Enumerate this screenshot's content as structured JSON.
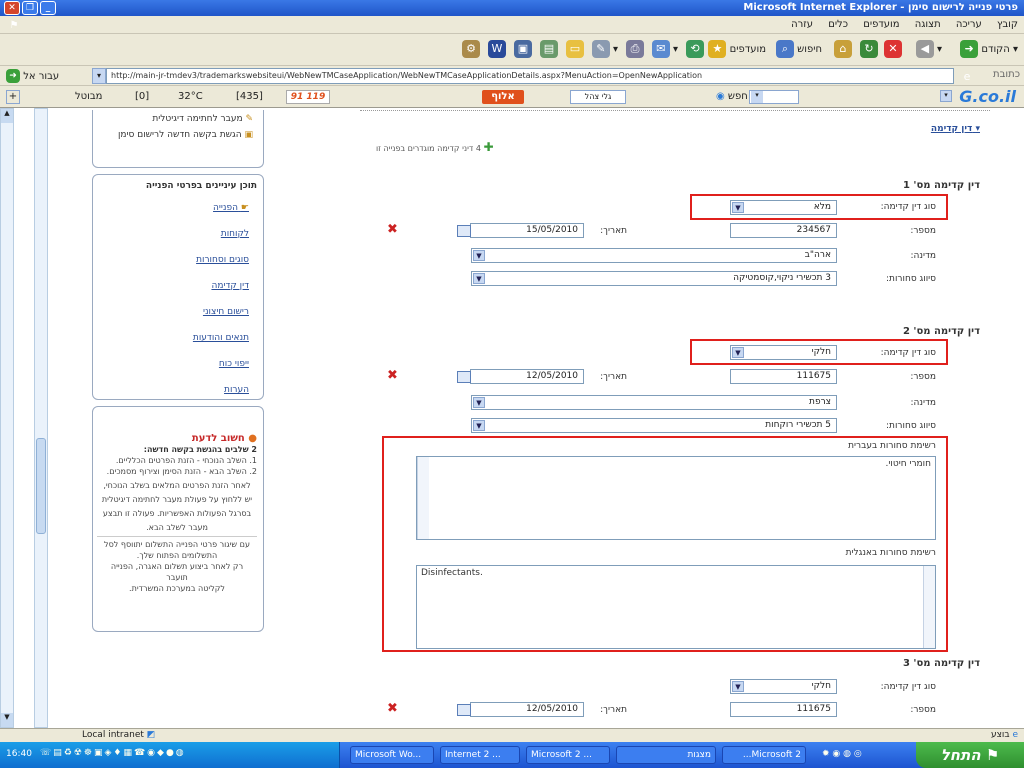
{
  "window": {
    "title": "פרטי פנייה לרישום סימן - Microsoft Internet Explorer"
  },
  "menu": [
    "קובץ",
    "עריכה",
    "תצוגה",
    "מועדפים",
    "כלים",
    "עזרה"
  ],
  "toolbar": {
    "back": "הקודם",
    "search": "חיפוש",
    "favorites": "מועדפים"
  },
  "address": {
    "label": "כתובת",
    "url": "http://main-jr-tmdev3/trademarkswebsiteui/WebNewTMCaseApplication/WebNewTMCaseApplicationDetails.aspx?MenuAction=OpenNewApplication",
    "go": "עבור אל"
  },
  "links": {
    "logo": "G.co.il",
    "search": "חפש",
    "alef": "אלוף",
    "temp": "32°C",
    "count_435": "[435]",
    "count_0": "[0]",
    "protected": "מבוטל",
    "news": "91 119",
    "gif": "גלי צהל"
  },
  "sidebar": {
    "top_items": [
      "מעבר לחתימה דיגיטלית",
      "הגשת בקשה חדשה לרישום סימן"
    ],
    "section_title": "תוכן עיניינים בפרטי הפנייה",
    "items": [
      "הפנייה",
      "לקוחות",
      "סוגים וסחורות",
      "דין קדימה",
      "רישום חיצוני",
      "תנאים והודעות",
      "ייפוי כוח",
      "הערות"
    ],
    "notice": {
      "title": "חשוב לדעת",
      "subtitle": "2 שלבים בהגשת בקשה חדשה:",
      "lines": [
        "1. השלב הנוכחי - הזנת הפרטים הכלליים.",
        "2. השלב הבא - הזנת הסימן וצירוף מסמכים.",
        "לאחר הזנת הפרטים המלאים בשלב הנוכחי,",
        "יש ללחוץ על פעולת מעבר לחתימה דיגיטלית",
        "בסרגל הפעולות האפשריות. פעולה זו תבצע",
        "מעבר לשלב הבא.",
        "עם שיגור פרטי הפנייה התשלום יתווסף לסל",
        "התשלומים הפתוח שלך.",
        "רק לאחר ביצוע תשלום האגרה, הפנייה",
        "תועבר",
        "לקליטה במערכת המשרדית."
      ]
    }
  },
  "main": {
    "header_link": "דין קדימה",
    "add_text": "4 דיני קדימה מוגדרים בפנייה זו",
    "labels": {
      "type": "סוג דין קדימה:",
      "number": "מספר:",
      "date": "תאריך:",
      "country": "מדינה:",
      "class": "סיווג סחורות:"
    },
    "priorities": [
      {
        "title": "דין קדימה מס' 1",
        "type": "מלא",
        "number": "234567",
        "date": "15/05/2010",
        "country": "ארה\"ב",
        "class": "3 תכשירי ניקוי,קוסמטיקה"
      },
      {
        "title": "דין קדימה מס' 2",
        "type": "חלקי",
        "number": "111675",
        "date": "12/05/2010",
        "country": "צרפת",
        "class": "5 תכשירי רוקחות"
      },
      {
        "title": "דין קדימה מס' 3",
        "type": "חלקי",
        "number": "111675",
        "date": "12/05/2010"
      }
    ],
    "goods_he": {
      "label": "רשימת סחורות בעברית",
      "value": "חומרי חיטוי."
    },
    "goods_en": {
      "label": "רשימת סחורות באנגלית",
      "value": "Disinfectants."
    }
  },
  "status": {
    "done": "בוצע",
    "zone": "Local intranet"
  },
  "taskbar": {
    "start": "התחל",
    "time": "16:40",
    "tasks": [
      "Microsoft Wo...",
      "Internet 2 ...",
      "Microsoft 2 ...",
      "מצגות",
      "Microsoft 2..."
    ]
  }
}
